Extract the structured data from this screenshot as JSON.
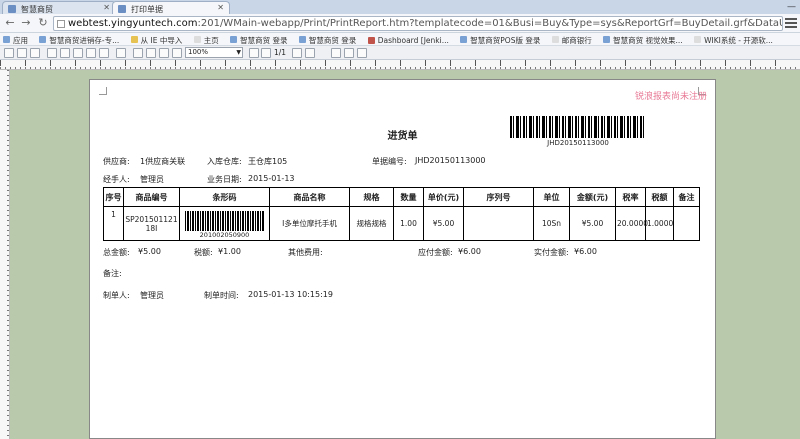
{
  "browser": {
    "tabs": [
      {
        "label": "智慧商贸"
      },
      {
        "label": "打印单据"
      }
    ],
    "window_control": "—",
    "url_host": "webtest.yingyuntech.com",
    "url_rest": ":201/WMain-webapp/Print/PrintReport.htm?templatecode=01&Busi=Buy&Type=sys&ReportGrf=BuyDetail.grf&DataUrl=/WBILL-webap",
    "bookmarks": [
      "应用",
      "智慧商贸进销存-专...",
      "从 IE 中导入",
      "主页",
      "智慧商贸 登录",
      "智慧商贸 登录",
      "Dashboard [Jenki...",
      "智慧商贸POS版 登录",
      "邮商银行",
      "智慧商贸 视觉效果...",
      "WIKI系统 - 开源软..."
    ]
  },
  "toolbar": {
    "zoom": "100%",
    "page_info": "1/1"
  },
  "report": {
    "watermark": "锐浪报表尚未注册",
    "title": "进货单",
    "barcode_text": "JHD20150113000",
    "supplier_label": "供应商:",
    "supplier_value": "1供应商关联",
    "warehouse_label": "入库仓库:",
    "warehouse_value": "王仓库105",
    "docno_label": "单据编号:",
    "docno_value": "JHD20150113000",
    "handler_label": "经手人:",
    "handler_value": "管理员",
    "bizdate_label": "业务日期:",
    "bizdate_value": "2015-01-13",
    "columns": [
      "序号",
      "商品编号",
      "条形码",
      "商品名称",
      "规格",
      "数量",
      "单价(元)",
      "序列号",
      "单位",
      "金额(元)",
      "税率",
      "税额",
      "备注"
    ],
    "row": {
      "index": "1",
      "code": "SP20150112118I",
      "barcode": "201002050900",
      "name": "I多单位摩托手机",
      "spec": "规格规格",
      "qty": "1.00",
      "price": "¥5.00",
      "serial": "",
      "unit": "10Sn",
      "amount": "¥5.00",
      "taxrate": "20.0000",
      "tax": "1.0000",
      "remark": ""
    },
    "total_label": "总金额:",
    "total_value": "¥5.00",
    "taxsum_label": "税额:",
    "taxsum_value": "¥1.00",
    "otherfee_label": "其他费用:",
    "otherfee_value": "",
    "payable_label": "应付金额:",
    "payable_value": "¥6.00",
    "paid_label": "实付金额:",
    "paid_value": "¥6.00",
    "note_label": "备注:",
    "maker_label": "制单人:",
    "maker_value": "管理员",
    "maketime_label": "制单时间:",
    "maketime_value": "2015-01-13 10:15:19"
  }
}
